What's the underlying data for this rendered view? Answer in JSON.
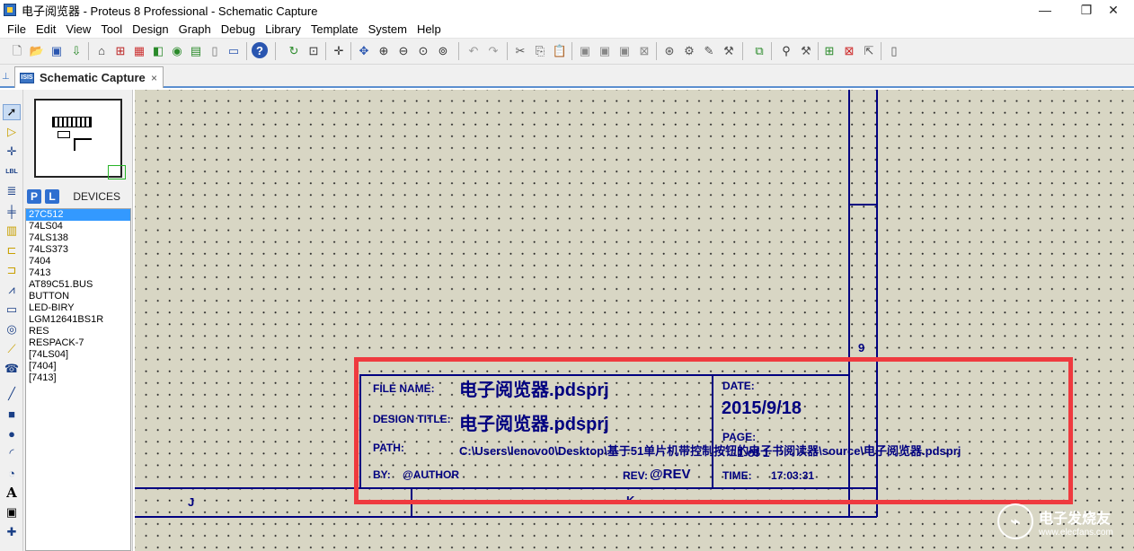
{
  "window": {
    "title": "电子阅览器 - Proteus 8 Professional - Schematic Capture",
    "minimize": "—",
    "maximize": "❐",
    "close": "✕"
  },
  "menu": [
    "File",
    "Edit",
    "View",
    "Tool",
    "Design",
    "Graph",
    "Debug",
    "Library",
    "Template",
    "System",
    "Help"
  ],
  "toolbar_icons": [
    "new-file-icon",
    "open-folder-icon",
    "save-icon",
    "import-icon",
    "home-icon",
    "schematic-icon",
    "pcb-icon",
    "3d-icon",
    "gerber-icon",
    "bom-icon",
    "notes-icon",
    "help-icon",
    "refresh-icon",
    "grid-icon",
    "origin-icon",
    "pan-icon",
    "zoom-in-icon",
    "zoom-out-icon",
    "zoom-all-icon",
    "zoom-area-icon",
    "undo-icon",
    "redo-icon",
    "cut-icon",
    "copy-icon",
    "paste-icon",
    "block-copy-icon",
    "block-move-icon",
    "block-rotate-icon",
    "block-delete-icon",
    "pick-device-icon",
    "make-device-icon",
    "package-tool-icon",
    "decompose-icon",
    "wire-autorouter-icon",
    "search-icon",
    "property-tool-icon",
    "new-sheet-icon",
    "remove-sheet-icon",
    "exit-to-parent-icon",
    "netlist-icon"
  ],
  "tab": {
    "label": "Schematic Capture",
    "icon_text": "ISIS",
    "close": "×"
  },
  "left_tools": [
    "selection-mode-icon",
    "component-mode-icon",
    "junction-dot-icon",
    "wire-label-icon",
    "text-script-icon",
    "buses-icon",
    "subcircuit-icon",
    "terminals-icon",
    "device-pins-icon",
    "graph-icon",
    "tape-recorder-icon",
    "generator-icon",
    "voltage-probe-icon",
    "current-probe-icon",
    "virtual-instrument-icon",
    "2d-line-icon",
    "2d-box-icon",
    "2d-circle-icon",
    "2d-arc-icon",
    "2d-path-icon",
    "2d-text-icon",
    "2d-symbol-icon"
  ],
  "panel": {
    "p_button": "P",
    "l_button": "L",
    "title": "DEVICES",
    "devices": [
      "27C512",
      "74LS04",
      "74LS138",
      "74LS373",
      "7404",
      "7413",
      "AT89C51.BUS",
      "BUTTON",
      "LED-BIRY",
      "LGM12641BS1R",
      "RES",
      "RESPACK-7",
      "[74LS04]",
      "[7404]",
      "[7413]"
    ],
    "selected_index": 0
  },
  "sheet": {
    "col_j": "J",
    "col_k": "K",
    "row_9": "9"
  },
  "title_block": {
    "file_name_label": "FILE NAME:",
    "file_name_value": "电子阅览器.pdsprj",
    "design_title_label": "DESIGN TITLE:",
    "design_title_value": "电子阅览器.pdsprj",
    "path_label": "PATH:",
    "path_value": "C:\\Users\\lenovo0\\Desktop\\基于51单片机带控制按钮的电子书阅读器\\source\\电子阅览器.pdsprj",
    "by_label": "BY:",
    "by_value": "@AUTHOR",
    "rev_label": "REV:",
    "rev_value": "@REV",
    "date_label": "DATE:",
    "date_value": "2015/9/18",
    "page_label": "PAGE:",
    "page_value": "1 of 1",
    "time_label": "TIME:",
    "time_value": "17:03:31"
  },
  "watermark": {
    "cn": "电子发烧友",
    "url": "www.elecfans.com"
  },
  "colors": {
    "sheet_bg": "#d8d6c4",
    "frame": "#000080",
    "highlight": "#ef3a3f",
    "selected": "#3399ff"
  }
}
